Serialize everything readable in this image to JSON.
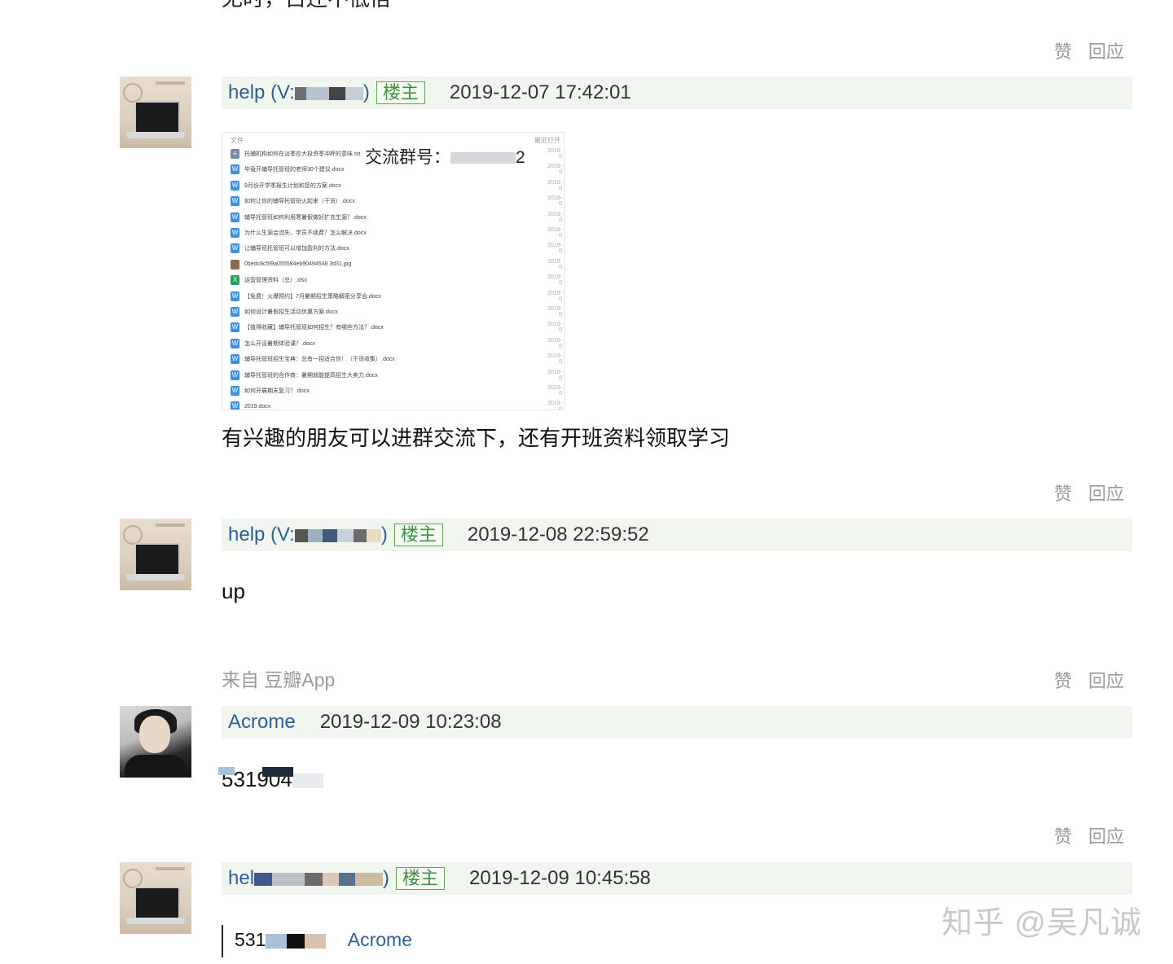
{
  "top_partial_text": "无时，占还不低倍",
  "actions": {
    "like": "赞",
    "reply": "回应"
  },
  "posts": [
    {
      "author": "help (V:",
      "author_tail": ")",
      "badge": "楼主",
      "time": "2019-12-07 17:42:01",
      "body": "有兴趣的朋友可以进群交流下，还有开班资料领取学习"
    },
    {
      "author": "help (V:",
      "author_tail": ")",
      "badge": "楼主",
      "time": "2019-12-08 22:59:52",
      "body": "up",
      "source": "来自 豆瓣App"
    },
    {
      "author": "Acrome",
      "time": "2019-12-09 10:23:08",
      "body": "531904"
    },
    {
      "author": "hel",
      "author_tail": ")",
      "badge": "楼主",
      "time": "2019-12-09 10:45:58",
      "quote_number": "531",
      "quote_author": "Acrome"
    }
  ],
  "screenshot": {
    "header_left": "文件",
    "header_right": "最近打开",
    "group_label": "交流群号：",
    "group_tail": "2",
    "files": [
      {
        "name": "托辅机构如何在淡季应大投资季冲杯的意味.txt",
        "date": "2019-0",
        "type": "txt"
      },
      {
        "name": "毕竟开辅导托管班的老师30个建议.docx",
        "date": "2019-0",
        "type": "doc"
      },
      {
        "name": "9月份开学季报生计划和您的方案.docx",
        "date": "2019-0",
        "type": "doc"
      },
      {
        "name": "如何让你的辅导托管班火起来（干货）.docx",
        "date": "2019-0",
        "type": "doc"
      },
      {
        "name": "辅导托管班如何利用寒暑假做好扩充生源？.docx",
        "date": "2019-0",
        "type": "doc"
      },
      {
        "name": "为什么生源会流失、学员不续费？怎么解决.docx",
        "date": "2019-0",
        "type": "doc"
      },
      {
        "name": "让辅导班托管班可以增加盈利的方法.docx",
        "date": "2019-0",
        "type": "doc"
      },
      {
        "name": "0bedc8c5f9a055584eb90494648 3d31.jpg",
        "date": "2019-0",
        "type": "img"
      },
      {
        "name": "运营管理资料（总）.xlsx",
        "date": "2019-0",
        "type": "xls"
      },
      {
        "name": "【免费！火爆预约】7月暑期招生策略解密分享会.docx",
        "date": "2019-0",
        "type": "doc"
      },
      {
        "name": "如何设计暑假招生活动优惠方案.docx",
        "date": "2019-0",
        "type": "doc"
      },
      {
        "name": "【值得收藏】辅导托管班如何招生？有哪些方法？.docx",
        "date": "2019-0",
        "type": "doc"
      },
      {
        "name": "怎么开设暑期体验课？.docx",
        "date": "2019-0",
        "type": "doc"
      },
      {
        "name": "辅导托管班招生宝典：总有一招适合你！（干货收集）.docx",
        "date": "2019-0",
        "type": "doc"
      },
      {
        "name": "辅导托管班的合作商：暑期就能提高招生大卖力.docx",
        "date": "2019-0",
        "type": "doc"
      },
      {
        "name": "如何开展期末复习？.docx",
        "date": "2019-0",
        "type": "doc"
      },
      {
        "name": "2019.docx",
        "date": "2019-0",
        "type": "doc"
      }
    ]
  },
  "watermark": "知乎 @吴凡诚",
  "colors": {
    "link": "#2e5f95",
    "badge": "#3f9140",
    "bar_bg": "#f0f6ee",
    "muted": "#9a9a9a"
  }
}
